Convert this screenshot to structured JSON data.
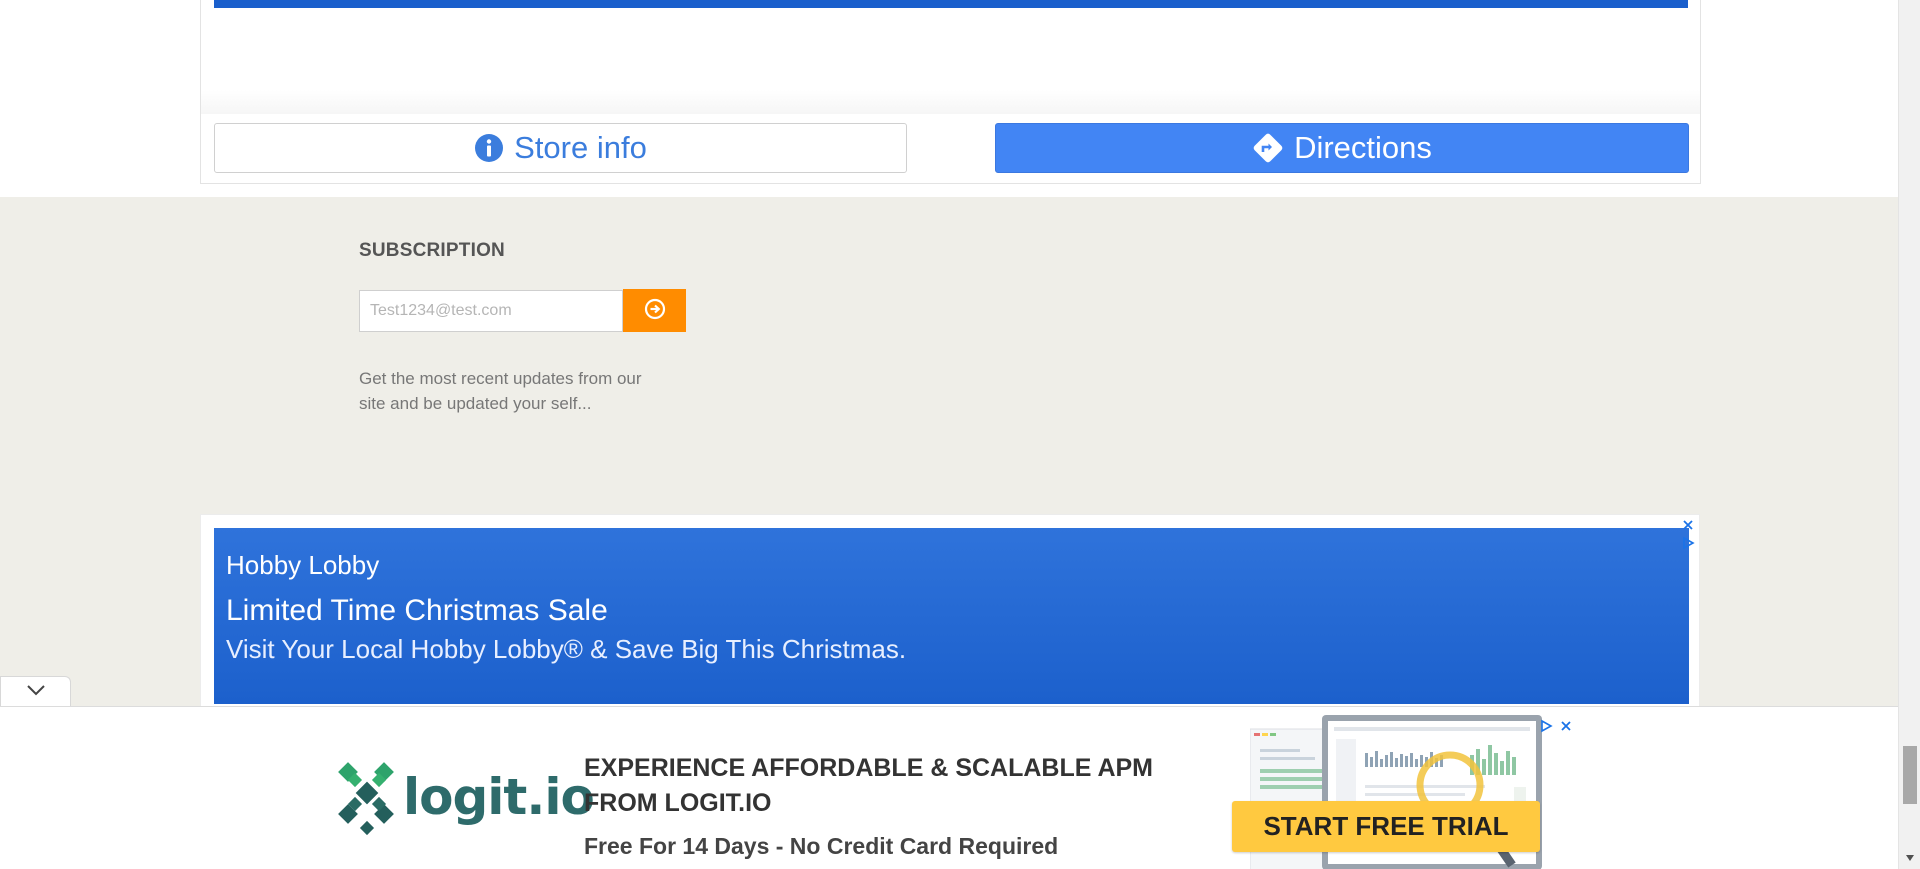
{
  "store_card": {
    "store_info_label": "Store info",
    "directions_label": "Directions"
  },
  "subscription": {
    "heading": "SUBSCRIPTION",
    "email_placeholder": "Test1234@test.com",
    "description": "Get the most recent updates from our site and be updated your self..."
  },
  "ad_banner": {
    "brand": "Hobby Lobby",
    "headline": "Limited Time Christmas Sale",
    "description": "Visit Your Local Hobby Lobby® & Save Big This Christmas."
  },
  "bottom_ad": {
    "logo_text": "logit.io",
    "headline": "EXPERIENCE AFFORDABLE & SCALABLE APM FROM LOGIT.IO",
    "subtext": "Free For 14 Days - No Credit Card Required",
    "cta_label": "START FREE TRIAL"
  },
  "icons": {
    "info": "info-icon",
    "directions": "directions-icon",
    "submit": "arrow-circle-right-icon",
    "close": "close-icon",
    "adchoices": "adchoices-icon",
    "collapse": "chevron-down-icon"
  },
  "colors": {
    "primary_blue": "#4285f4",
    "ad_blue": "#1c60cc",
    "subscribe_orange": "#ff8c00",
    "cta_yellow": "#ffc940",
    "footer_bg": "#efeee8"
  }
}
